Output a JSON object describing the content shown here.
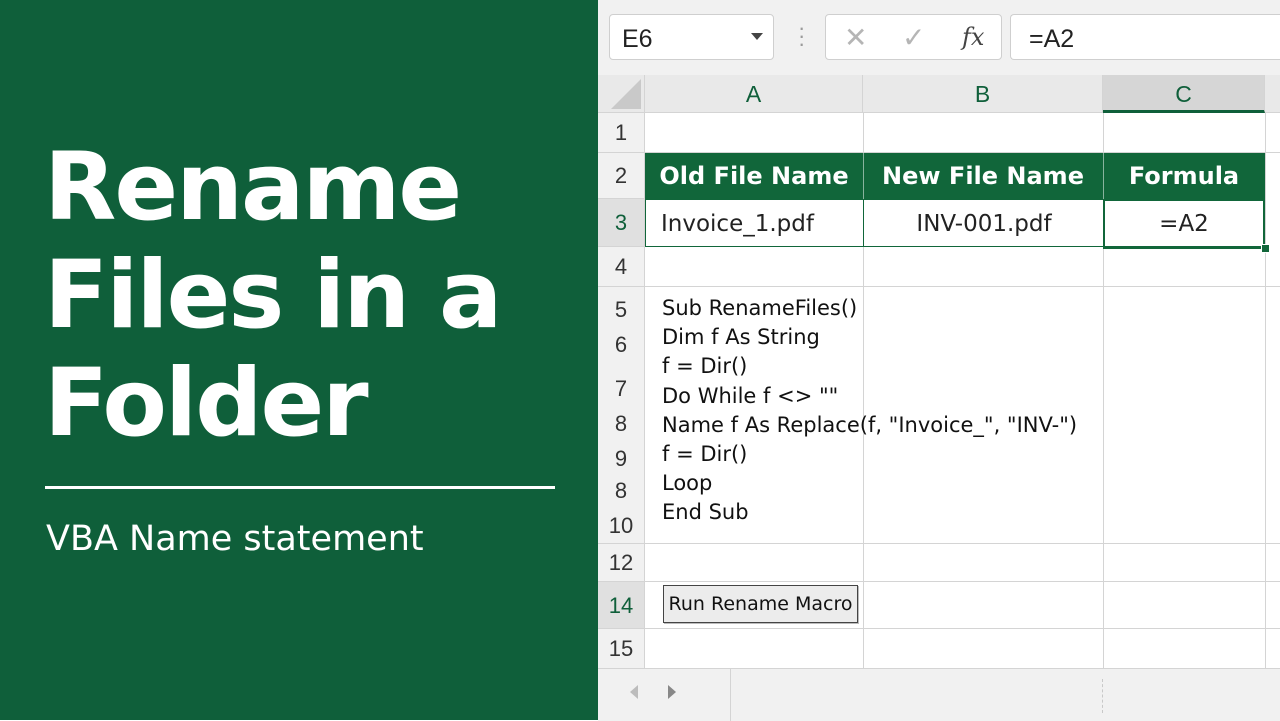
{
  "banner": {
    "title_lines": [
      "Rename",
      "Files in a",
      "Folder"
    ],
    "subtitle": "VBA Name statement"
  },
  "formula_bar": {
    "name_box": "E6",
    "cancel_icon": "✕",
    "enter_icon": "✓",
    "fx_label": "fx",
    "formula": "=A2"
  },
  "columns": [
    "A",
    "B",
    "C"
  ],
  "rows": [
    "1",
    "2",
    "3",
    "4",
    "5",
    "6",
    "7",
    "8",
    "9",
    "8",
    "10",
    "12",
    "14",
    "15"
  ],
  "table": {
    "headers": [
      "Old File Name",
      "New File Name",
      "Formula"
    ],
    "row": [
      "Invoice_1.pdf",
      "INV-001.pdf",
      "=A2"
    ]
  },
  "code_lines": [
    "Sub RenameFiles()",
    "Dim f As String",
    "f = Dir()",
    "Do While f <> \"\"",
    "Name f As Replace(f, \"Invoice_\", \"INV-\")",
    "f = Dir()",
    "Loop",
    "End Sub"
  ],
  "macro_button": "Run Rename Macro",
  "colors": {
    "brand_green": "#0f5f3a",
    "header_green": "#11663a"
  }
}
